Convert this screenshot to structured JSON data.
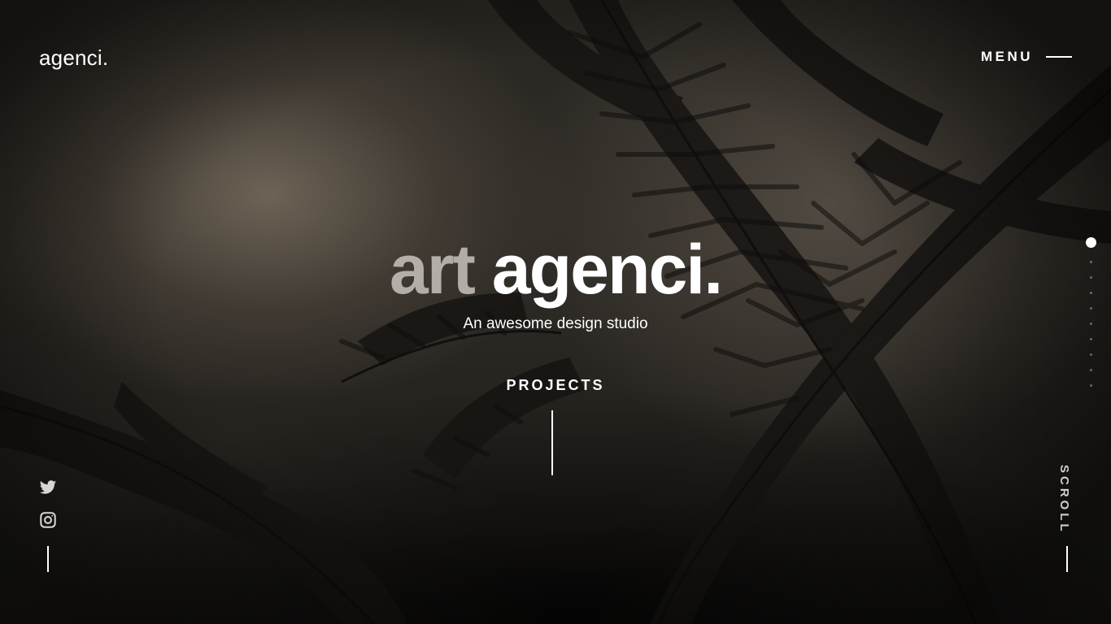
{
  "header": {
    "logo": "agenci.",
    "menu_label": "MENU"
  },
  "hero": {
    "title_part1": "art",
    "title_part2": "agenci.",
    "subtitle": "An awesome design studio",
    "cta_label": "PROJECTS"
  },
  "social": {
    "icons": [
      "twitter-icon",
      "instagram-icon"
    ]
  },
  "slider": {
    "total_slides": 10,
    "active_slide": 1
  },
  "scroll_label": "SCROLL",
  "colors": {
    "text": "#ffffff",
    "title_muted": "#c8c3bc",
    "background": "#2a2722"
  }
}
